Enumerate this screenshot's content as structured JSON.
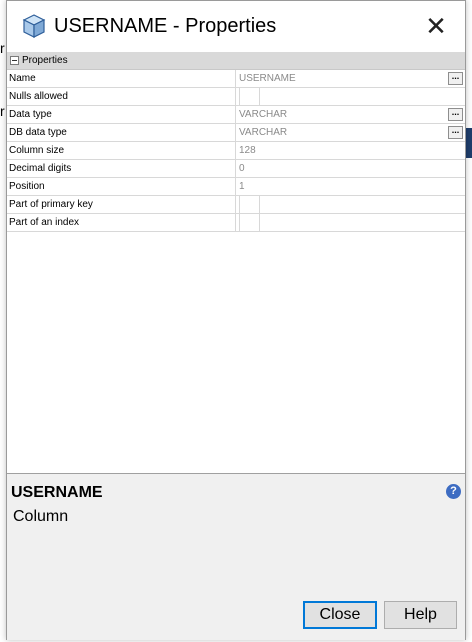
{
  "dialog": {
    "title": "USERNAME - Properties",
    "close_glyph": "✕",
    "icon": "cube-icon"
  },
  "background": {
    "text_1": "r",
    "text_2": "r"
  },
  "grid": {
    "section_label": "Properties",
    "rows": [
      {
        "name": "Name",
        "value": "USERNAME",
        "kind": "text",
        "button": true
      },
      {
        "name": "Nulls allowed",
        "value": "",
        "kind": "checkbox",
        "button": false
      },
      {
        "name": "Data type",
        "value": "VARCHAR",
        "kind": "text",
        "button": true
      },
      {
        "name": "DB data type",
        "value": "VARCHAR",
        "kind": "text",
        "button": true
      },
      {
        "name": "Column size",
        "value": "128",
        "kind": "text",
        "button": false
      },
      {
        "name": "Decimal digits",
        "value": "0",
        "kind": "text",
        "button": false
      },
      {
        "name": "Position",
        "value": "1",
        "kind": "text",
        "button": false
      },
      {
        "name": "Part of primary key",
        "value": "",
        "kind": "checkbox",
        "button": false
      },
      {
        "name": "Part of an index",
        "value": "",
        "kind": "checkbox",
        "button": false
      }
    ],
    "ellipsis_label": "..."
  },
  "description": {
    "title": "USERNAME",
    "subtitle": "Column",
    "help_glyph": "?"
  },
  "buttons": {
    "close_label": "Close",
    "help_label": "Help"
  },
  "colors": {
    "section_header": "#d9d9d9",
    "panel_bg": "#f0f0f0",
    "accent": "#0078d7",
    "help_icon": "#3d6cc2"
  }
}
